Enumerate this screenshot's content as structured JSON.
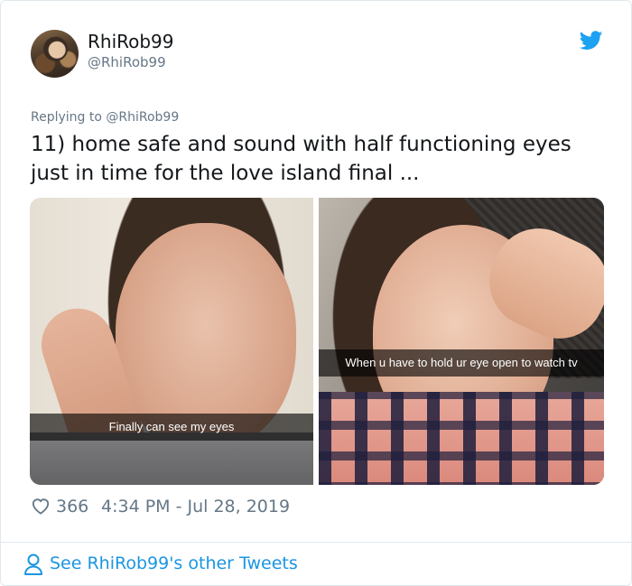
{
  "author": {
    "display_name": "RhiRob99",
    "handle": "@RhiRob99"
  },
  "reply": {
    "prefix": "Replying to ",
    "mention": "@RhiRob99"
  },
  "tweet": {
    "text": "11) home safe and sound with half functioning eyes just in time for the love island final ..."
  },
  "media": [
    {
      "caption": "Finally can see my eyes"
    },
    {
      "caption": "When u have to hold ur eye open to watch tv"
    }
  ],
  "footer": {
    "likes": "366",
    "timestamp": "4:34 PM - Jul 28, 2019",
    "other_tweets": "See RhiRob99's other Tweets"
  },
  "colors": {
    "twitter_blue": "#1da1f2",
    "link_blue": "#1b95e0",
    "muted_gray": "#657786",
    "text_dark": "#14171a"
  },
  "icons": [
    "twitter-bird-icon",
    "heart-icon",
    "person-icon"
  ]
}
